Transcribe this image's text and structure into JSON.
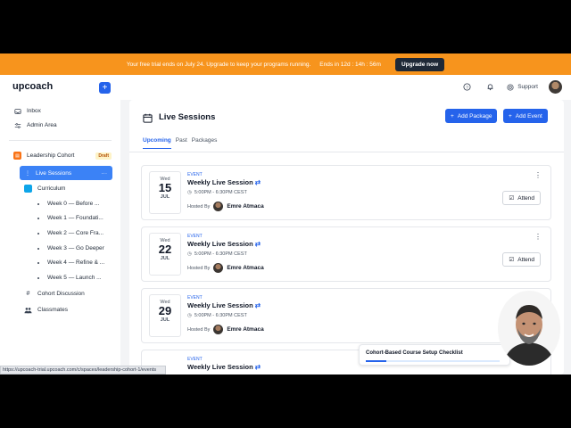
{
  "banner": {
    "message": "Your free trial ends on July 24. Upgrade to keep your programs running.",
    "countdown": "Ends in 12d : 14h : 56m",
    "upgrade_label": "Upgrade now"
  },
  "topbar": {
    "logo": "upcoach",
    "add_icon": "plus-icon",
    "help_icon": "question-circle-icon",
    "bell_icon": "bell-icon",
    "support_label": "Support"
  },
  "sidebar": {
    "inbox": "Inbox",
    "admin": "Admin Area",
    "program": "Leadership Cohort",
    "draft": "Draft",
    "live_sessions": "Live Sessions",
    "curriculum": "Curriculum",
    "weeks": [
      "Week 0 — Before ...",
      "Week 1 — Foundati...",
      "Week 2 — Core Fra...",
      "Week 3 — Go Deeper",
      "Week 4 — Refine & ...",
      "Week 5 — Launch ..."
    ],
    "discussion": "Cohort Discussion",
    "classmates": "Classmates"
  },
  "main": {
    "title": "Live Sessions",
    "add_package": "Add Package",
    "add_event": "Add Event",
    "tabs": [
      "Upcoming",
      "Past",
      "Packages"
    ]
  },
  "events": [
    {
      "kind": "EVENT",
      "title": "Weekly Live Session",
      "dow": "Wed",
      "day": "15",
      "month": "JUL",
      "time": "5:00PM - 6:30PM CEST",
      "hosted_by": "Hosted By",
      "host": "Emre Atmaca",
      "attend": "Attend"
    },
    {
      "kind": "EVENT",
      "title": "Weekly Live Session",
      "dow": "Wed",
      "day": "22",
      "month": "JUL",
      "time": "5:00PM - 6:30PM CEST",
      "hosted_by": "Hosted By",
      "host": "Emre Atmaca",
      "attend": "Attend"
    },
    {
      "kind": "EVENT",
      "title": "Weekly Live Session",
      "dow": "Wed",
      "day": "29",
      "month": "JUL",
      "time": "5:00PM - 6:30PM CEST",
      "hosted_by": "Hosted By",
      "host": "Emre Atmaca",
      "attend": ""
    },
    {
      "kind": "EVENT",
      "title": "Weekly Live Session",
      "dow": "",
      "day": "",
      "month": "",
      "time": "",
      "hosted_by": "",
      "host": "",
      "attend": ""
    }
  ],
  "checklist": {
    "title": "Cohort-Based Course Setup Checklist",
    "progress": 0.15
  },
  "status_url": "https://upcoach-trial.upcoach.com/c/spaces/leadership-cohort-1/events"
}
